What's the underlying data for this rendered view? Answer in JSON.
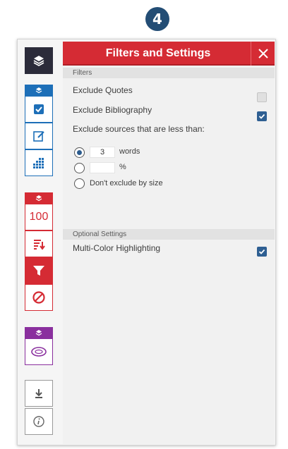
{
  "step_number": "4",
  "panel": {
    "title": "Filters and Settings",
    "close_icon": "close-icon",
    "accent_color": "#d52b34",
    "checkbox_color": "#2e5f92"
  },
  "filters": {
    "header": "Filters",
    "exclude_quotes": {
      "label": "Exclude Quotes",
      "checked": false
    },
    "exclude_bibliography": {
      "label": "Exclude Bibliography",
      "checked": true
    },
    "exclude_small_label": "Exclude sources that are less than:",
    "words_option": {
      "value": "3",
      "unit": "words",
      "selected": true
    },
    "percent_option": {
      "value": "",
      "unit": "%",
      "selected": false
    },
    "no_size_option": {
      "label": "Don't exclude by size",
      "selected": false
    }
  },
  "optional": {
    "header": "Optional Settings",
    "multicolor": {
      "label": "Multi-Color Highlighting",
      "checked": true
    }
  },
  "rail": {
    "layers_icon": "layers-icon",
    "checkbox_icon": "checkbox-icon",
    "edit_icon": "edit-icon",
    "grid_icon": "grid-icon",
    "similarity_score": "100",
    "sort_icon": "sort-icon",
    "filter_icon": "filter-icon",
    "exclude_icon": "no-entry-icon",
    "ets_icon": "ets-icon",
    "download_icon": "download-icon",
    "info_icon": "info-icon",
    "group_colors": [
      "#1d6fb8",
      "#d52b34",
      "#8a2f9e"
    ]
  }
}
